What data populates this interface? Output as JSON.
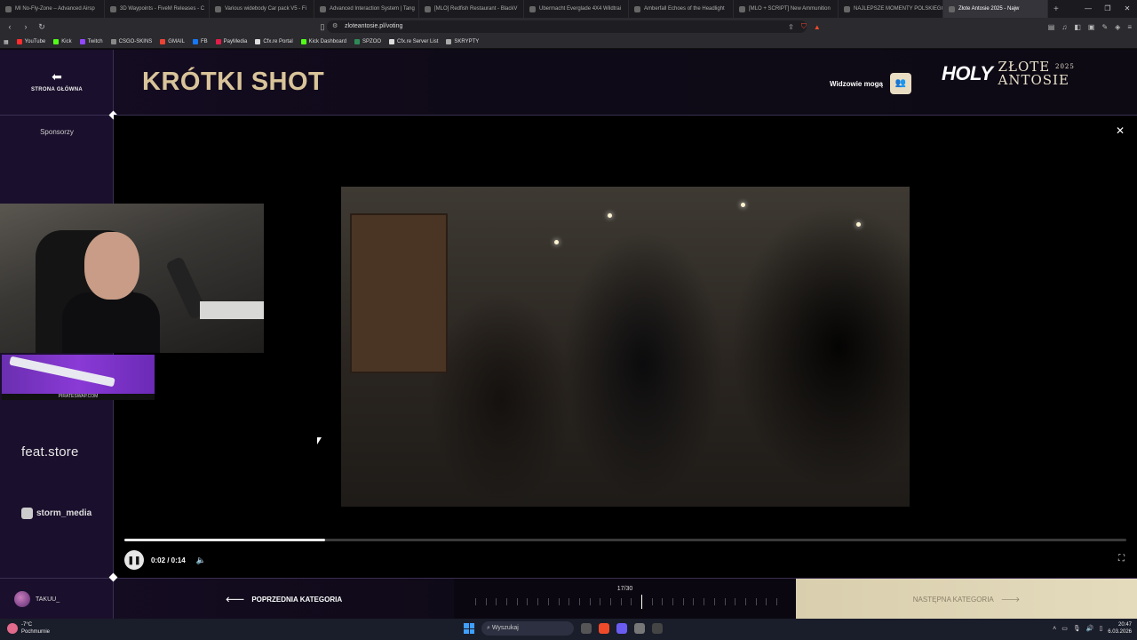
{
  "browser": {
    "tabs": [
      {
        "title": "MI No-Fly-Zone – Advanced Airsp",
        "active": false
      },
      {
        "title": "3D Waypoints - FiveM Releases - C",
        "active": false
      },
      {
        "title": "Various widebody Car pack V5 - Fi",
        "active": false
      },
      {
        "title": "Advanced Interaction System | Tang",
        "active": false
      },
      {
        "title": "[MLO] Redfish Restaurant - BlackV",
        "active": false
      },
      {
        "title": "Ubermacht Everglade 4X4 Wildtrai",
        "active": false
      },
      {
        "title": "Amberfall Echoes of the Headlight",
        "active": false
      },
      {
        "title": "[MLO + SCRIPT] New Ammunition",
        "active": false
      },
      {
        "title": "NAJLEPSZE MOMENTY POLSKIEGO",
        "active": false
      },
      {
        "title": "Złote Antosie 2025 - Najw",
        "active": true
      }
    ],
    "new_tab": "+",
    "url": "zloteantosie.pl/voting",
    "bookmarks": [
      {
        "label": "YouTube",
        "color": "#ff2d2d"
      },
      {
        "label": "Kick",
        "color": "#53fc18"
      },
      {
        "label": "Twitch",
        "color": "#9146ff"
      },
      {
        "label": "CSGO-SKINS",
        "color": "#888888"
      },
      {
        "label": "GMAIL",
        "color": "#ea4335"
      },
      {
        "label": "FB",
        "color": "#1877f2"
      },
      {
        "label": "PayMedia",
        "color": "#e11d48"
      },
      {
        "label": "Cfx.re Portal",
        "color": "#dddddd"
      },
      {
        "label": "Kick Dashboard",
        "color": "#53fc18"
      },
      {
        "label": "SPZOO",
        "color": "#2e8b57"
      },
      {
        "label": "Cfx.re Server List",
        "color": "#dddddd"
      },
      {
        "label": "SKRYPTY",
        "color": "#aaaaaa"
      }
    ]
  },
  "sidebar": {
    "home_label": "STRONA GŁÓWNA",
    "sponsors_label": "Sponsorzy",
    "sponsor_feat": "feat.store",
    "sponsor_storm": "storm_media"
  },
  "header": {
    "category_title": "KRÓTKI SHOT",
    "viewers_label": "Widzowie mogą",
    "logo_holy": "HOLY",
    "logo_line1": "ZŁOTE",
    "logo_line2": "ANTOSIE",
    "logo_year": "2025"
  },
  "player": {
    "time": "0:02 / 0:14",
    "progress": 0.2
  },
  "overlay": {
    "ad_caption": "PIRATESWAP.COM"
  },
  "footer": {
    "username": "TAKUU_",
    "prev_label": "POPRZEDNIA KATEGORIA",
    "next_label": "NASTĘPNA KATEGORIA",
    "category_count": "17/30",
    "current_index": 17,
    "total": 30
  },
  "taskbar": {
    "temperature": "-7°C",
    "weather": "Pochmurnie",
    "search_placeholder": "Wyszukaj",
    "time": "20:47",
    "date": "6.03.2026"
  }
}
